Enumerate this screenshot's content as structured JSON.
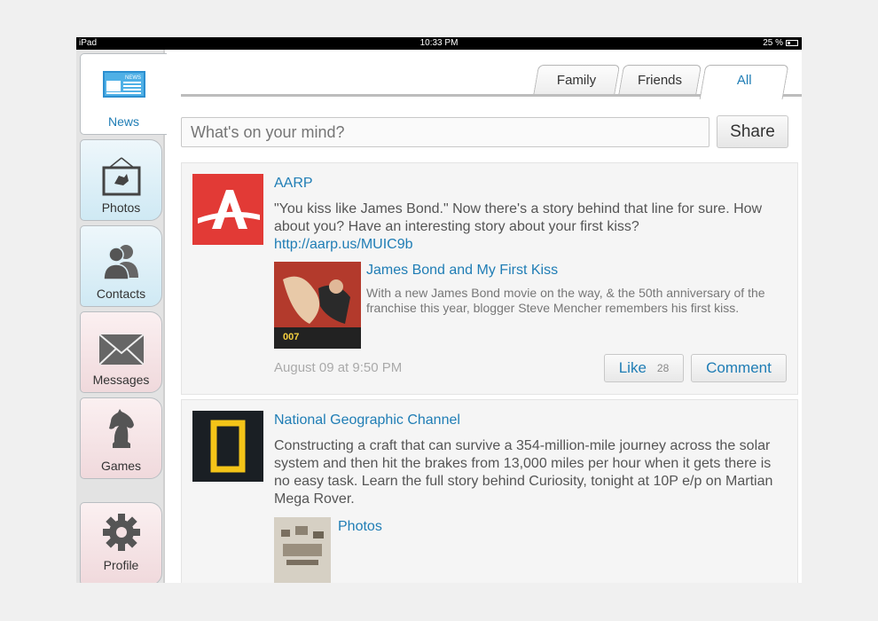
{
  "statusbar": {
    "device": "iPad",
    "time": "10:33 PM",
    "battery": "25 %",
    "battery_fraction": 0.25
  },
  "sidebar": {
    "items": [
      {
        "label": "News",
        "icon": "newspaper-icon"
      },
      {
        "label": "Photos",
        "icon": "picture-frame-icon"
      },
      {
        "label": "Contacts",
        "icon": "people-icon"
      },
      {
        "label": "Messages",
        "icon": "envelope-icon"
      },
      {
        "label": "Games",
        "icon": "chess-knight-icon"
      },
      {
        "label": "Profile",
        "icon": "gear-icon"
      }
    ],
    "news_icon_text": "NEWS"
  },
  "filter_tabs": [
    {
      "label": "Family"
    },
    {
      "label": "Friends"
    },
    {
      "label": "All",
      "selected": true
    }
  ],
  "composer": {
    "placeholder": "What's on your mind?",
    "share_label": "Share"
  },
  "posts": [
    {
      "author": "AARP",
      "text": "\"You kiss like James Bond.\" Now there's a story behind that line for sure. How about you? Have an interesting story about your first kiss?",
      "link": "http://aarp.us/MUIC9b",
      "attachment_title": "James Bond and My First Kiss",
      "attachment_desc": "With a new James Bond movie on the way, & the 50th anniversary of the franchise this year, blogger Steve Mencher remembers his first kiss.",
      "timestamp": "August 09 at 9:50 PM",
      "like_label": "Like",
      "like_count": "28",
      "comment_label": "Comment"
    },
    {
      "author": "National Geographic Channel",
      "text": "Constructing a craft that can survive a 354-million-mile journey across the solar system and then hit the brakes from 13,000 miles per hour when it gets there is no easy task. Learn the full story behind Curiosity, tonight at 10P e/p on Martian Mega Rover.",
      "attachment_title": "Photos"
    }
  ],
  "colors": {
    "accent": "#1f7db5",
    "aarp_red": "#e23a36",
    "natgeo_yellow": "#f4c418"
  }
}
